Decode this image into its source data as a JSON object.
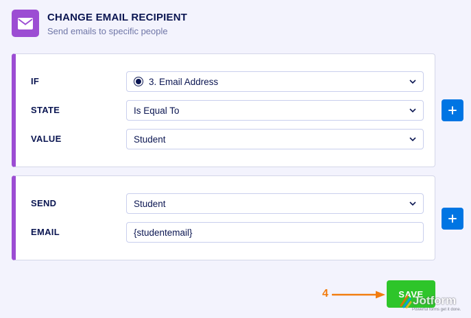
{
  "header": {
    "title": "CHANGE EMAIL RECIPIENT",
    "subtitle": "Send emails to specific people",
    "icon": "envelope-icon"
  },
  "condition": {
    "if_label": "IF",
    "if_value": "3. Email Address",
    "state_label": "STATE",
    "state_value": "Is Equal To",
    "value_label": "VALUE",
    "value_value": "Student"
  },
  "action": {
    "send_label": "SEND",
    "send_value": "Student",
    "email_label": "EMAIL",
    "email_value": "{studentemail}"
  },
  "footer": {
    "save_label": "SAVE",
    "step_number": "4"
  },
  "watermark": {
    "brand": "Jotform",
    "tagline": "Powerful forms get it done."
  },
  "colors": {
    "accent": "#9c4dd3",
    "primary_button": "#0075e3",
    "save_button": "#2ec52a",
    "annotation": "#f27c0e",
    "background": "#f3f3fd"
  }
}
